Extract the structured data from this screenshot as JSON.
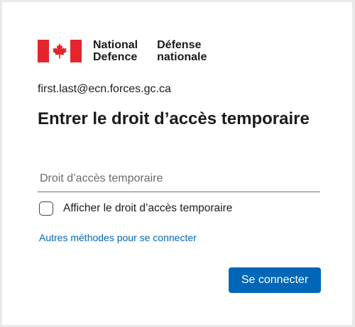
{
  "brand": {
    "en_line1": "National",
    "en_line2": "Defence",
    "fr_line1": "Défense",
    "fr_line2": "nationale",
    "flag_red": "#e5242b"
  },
  "account": {
    "email": "first.last@ecn.forces.gc.ca"
  },
  "page": {
    "title": "Entrer le droit d’accès temporaire"
  },
  "form": {
    "tap_placeholder": "Droit d’accès temporaire",
    "tap_value": "",
    "show_label": "Afficher le droit d’accès temporaire",
    "show_checked": false,
    "alt_methods_link": "Autres méthodes pour se connecter",
    "submit_label": "Se connecter"
  },
  "colors": {
    "accent": "#0067b8",
    "background": "#ffffff"
  }
}
